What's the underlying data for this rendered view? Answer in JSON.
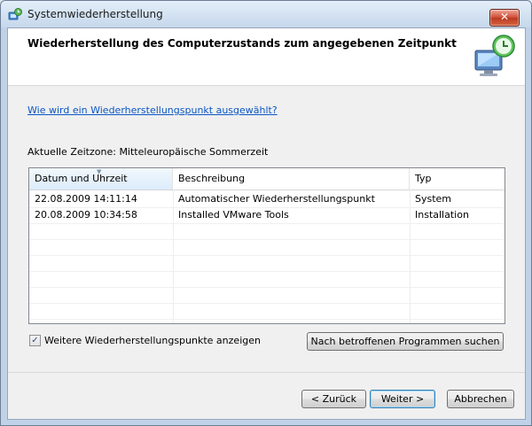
{
  "window": {
    "title": "Systemwiederherstellung",
    "close_label": "✕"
  },
  "header": {
    "title": "Wiederherstellung des Computerzustands zum angegebenen Zeitpunkt"
  },
  "help_link": "Wie wird ein Wiederherstellungspunkt ausgewählt?",
  "timezone_label": "Aktuelle Zeitzone: Mitteleuropäische Sommerzeit",
  "table": {
    "columns": [
      "Datum und Uhrzeit",
      "Beschreibung",
      "Typ"
    ],
    "rows": [
      [
        "22.08.2009 14:11:14",
        "Automatischer Wiederherstellungspunkt",
        "System"
      ],
      [
        "20.08.2009 10:34:58",
        "Installed VMware Tools",
        "Installation"
      ]
    ]
  },
  "show_more": {
    "checked": true,
    "check_glyph": "✓",
    "label": "Weitere Wiederherstellungspunkte anzeigen"
  },
  "buttons": {
    "scan": "Nach betroffenen Programmen suchen",
    "back": "< Zurück",
    "next": "Weiter >",
    "cancel": "Abbrechen"
  },
  "colors": {
    "link": "#0b57c6",
    "close_button": "#cf4b35"
  }
}
